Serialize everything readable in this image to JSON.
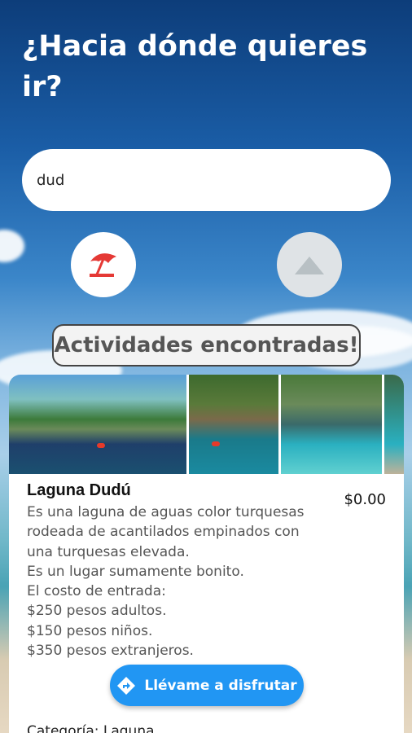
{
  "header": {
    "title": "¿Hacia dónde quieres ir?"
  },
  "search": {
    "value": "dud"
  },
  "categories": [
    {
      "name": "beach",
      "icon": "beach-umbrella-icon",
      "color": "#e53935",
      "selected": true
    },
    {
      "name": "mountain",
      "icon": "mountain-icon",
      "color": "#b8c0c4",
      "selected": false
    }
  ],
  "results": {
    "heading": "Actividades encontradas!",
    "card": {
      "name": "Laguna Dudú",
      "price": "$0.00",
      "description": "Es una laguna de aguas color turquesas\nrodeada de acantilados empinados con\nuna turquesas elevada.\nEs un lugar sumamente bonito.\nEl costo de entrada:\n$250 pesos adultos.\n$150 pesos niños.\n$350 pesos extranjeros.",
      "button_label": "Llévame a disfrutar",
      "button_icon": "directions-icon",
      "category": "Categoría: Laguna"
    }
  },
  "colors": {
    "accent": "#2196f3",
    "heading_text": "#555555"
  }
}
